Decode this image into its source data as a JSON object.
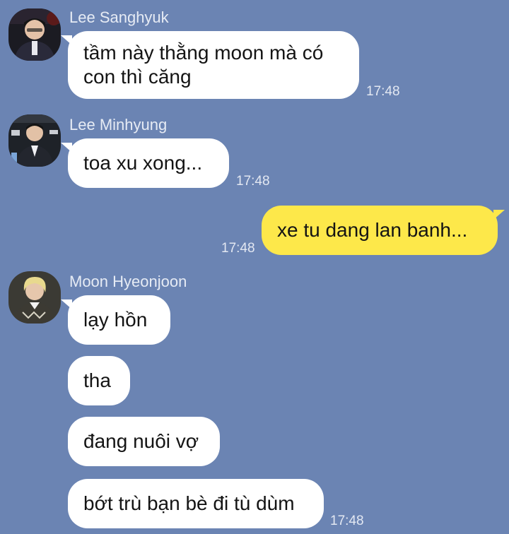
{
  "theme": {
    "background": "#6b84b3",
    "incoming_bubble": "#ffffff",
    "outgoing_bubble": "#fde84a"
  },
  "groups": [
    {
      "sender": "Lee Sanghyuk",
      "avatar_icon": "profile-photo",
      "messages": [
        {
          "text": "tầm này thằng moon mà có\ncon thì căng",
          "time": "17:48"
        }
      ]
    },
    {
      "sender": "Lee Minhyung",
      "avatar_icon": "profile-photo",
      "messages": [
        {
          "text": "toa xu xong...",
          "time": "17:48"
        }
      ]
    },
    {
      "sender": "me",
      "messages": [
        {
          "text": "xe tu dang lan banh...",
          "time": "17:48"
        }
      ]
    },
    {
      "sender": "Moon Hyeonjoon",
      "avatar_icon": "profile-photo",
      "messages": [
        {
          "text": "lạy hồn"
        },
        {
          "text": "tha"
        },
        {
          "text": "đang nuôi vợ"
        },
        {
          "text": "bớt trù bạn bè đi tù dùm",
          "time": "17:48"
        }
      ]
    }
  ]
}
